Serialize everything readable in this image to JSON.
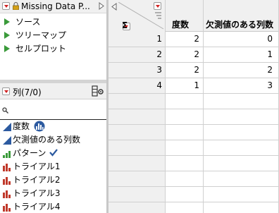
{
  "left_panel": {
    "table_title": "Missing Data P...",
    "scripts": [
      "ソース",
      "ツリーマップ",
      "セルプロット"
    ],
    "columns_header": "列(7/0)",
    "search_placeholder": "",
    "columns": [
      {
        "name": "度数",
        "icon": "continuous-icon",
        "badge": "frequency-role-icon"
      },
      {
        "name": "欠測値のある列数",
        "icon": "continuous-icon"
      },
      {
        "name": "パターン",
        "icon": "ordinal-icon",
        "badge": "checkmark-icon"
      },
      {
        "name": "トライアル1",
        "icon": "nominal-icon"
      },
      {
        "name": "トライアル2",
        "icon": "nominal-icon"
      },
      {
        "name": "トライアル3",
        "icon": "nominal-icon"
      },
      {
        "name": "トライアル4",
        "icon": "nominal-icon"
      }
    ]
  },
  "table": {
    "headers": [
      "度数",
      "欠測値のある列数"
    ],
    "rows": [
      {
        "num": "1",
        "vals": [
          "2",
          "0"
        ]
      },
      {
        "num": "2",
        "vals": [
          "2",
          "1"
        ]
      },
      {
        "num": "3",
        "vals": [
          "2",
          "2"
        ]
      },
      {
        "num": "4",
        "vals": [
          "1",
          "3"
        ]
      }
    ]
  },
  "colors": {
    "accent_red": "#d02020",
    "script_green": "#3a9a3a",
    "col_blue": "#2c5aa0",
    "nominal_red": "#c0392b"
  }
}
